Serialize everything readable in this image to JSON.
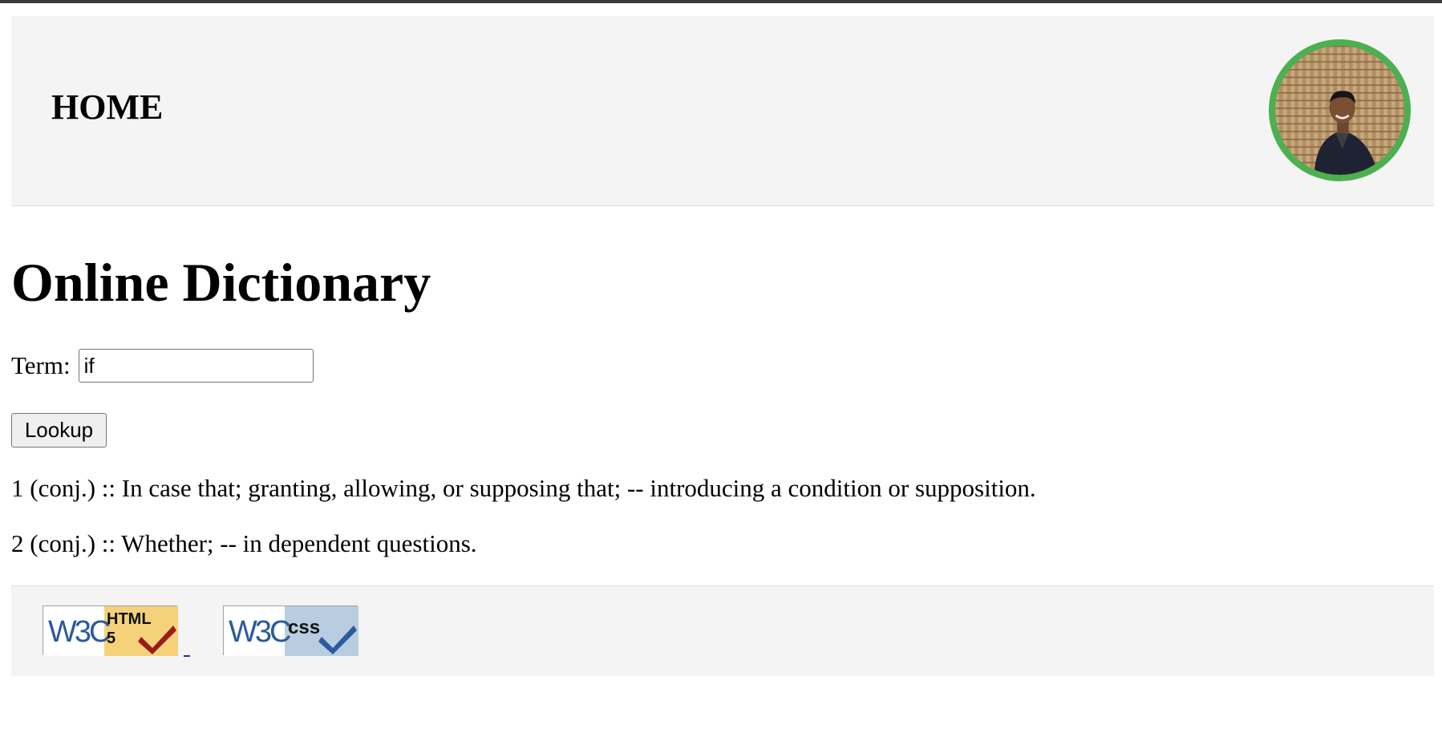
{
  "header": {
    "home_label": "HOME",
    "avatar_alt": "profile photo"
  },
  "main": {
    "title": "Online Dictionary",
    "term_label": "Term:",
    "term_value": "if",
    "lookup_label": "Lookup",
    "definitions": [
      "1 (conj.) :: In case that; granting, allowing, or supposing that; -- introducing a condition or supposition.",
      "2 (conj.) :: Whether; -- in dependent questions."
    ]
  },
  "footer": {
    "html_badge": {
      "w3c": "W3C",
      "line1": "HTML",
      "line2": "5"
    },
    "css_badge": {
      "w3c": "W3C",
      "label": "css"
    }
  },
  "colors": {
    "avatar_ring": "#4caf50",
    "html_badge_bg": "#f5d27a",
    "html_check": "#9b1b1b",
    "css_badge_bg": "#b9cde0",
    "css_check": "#2a5b9c",
    "w3c_text": "#2a5b9c"
  }
}
